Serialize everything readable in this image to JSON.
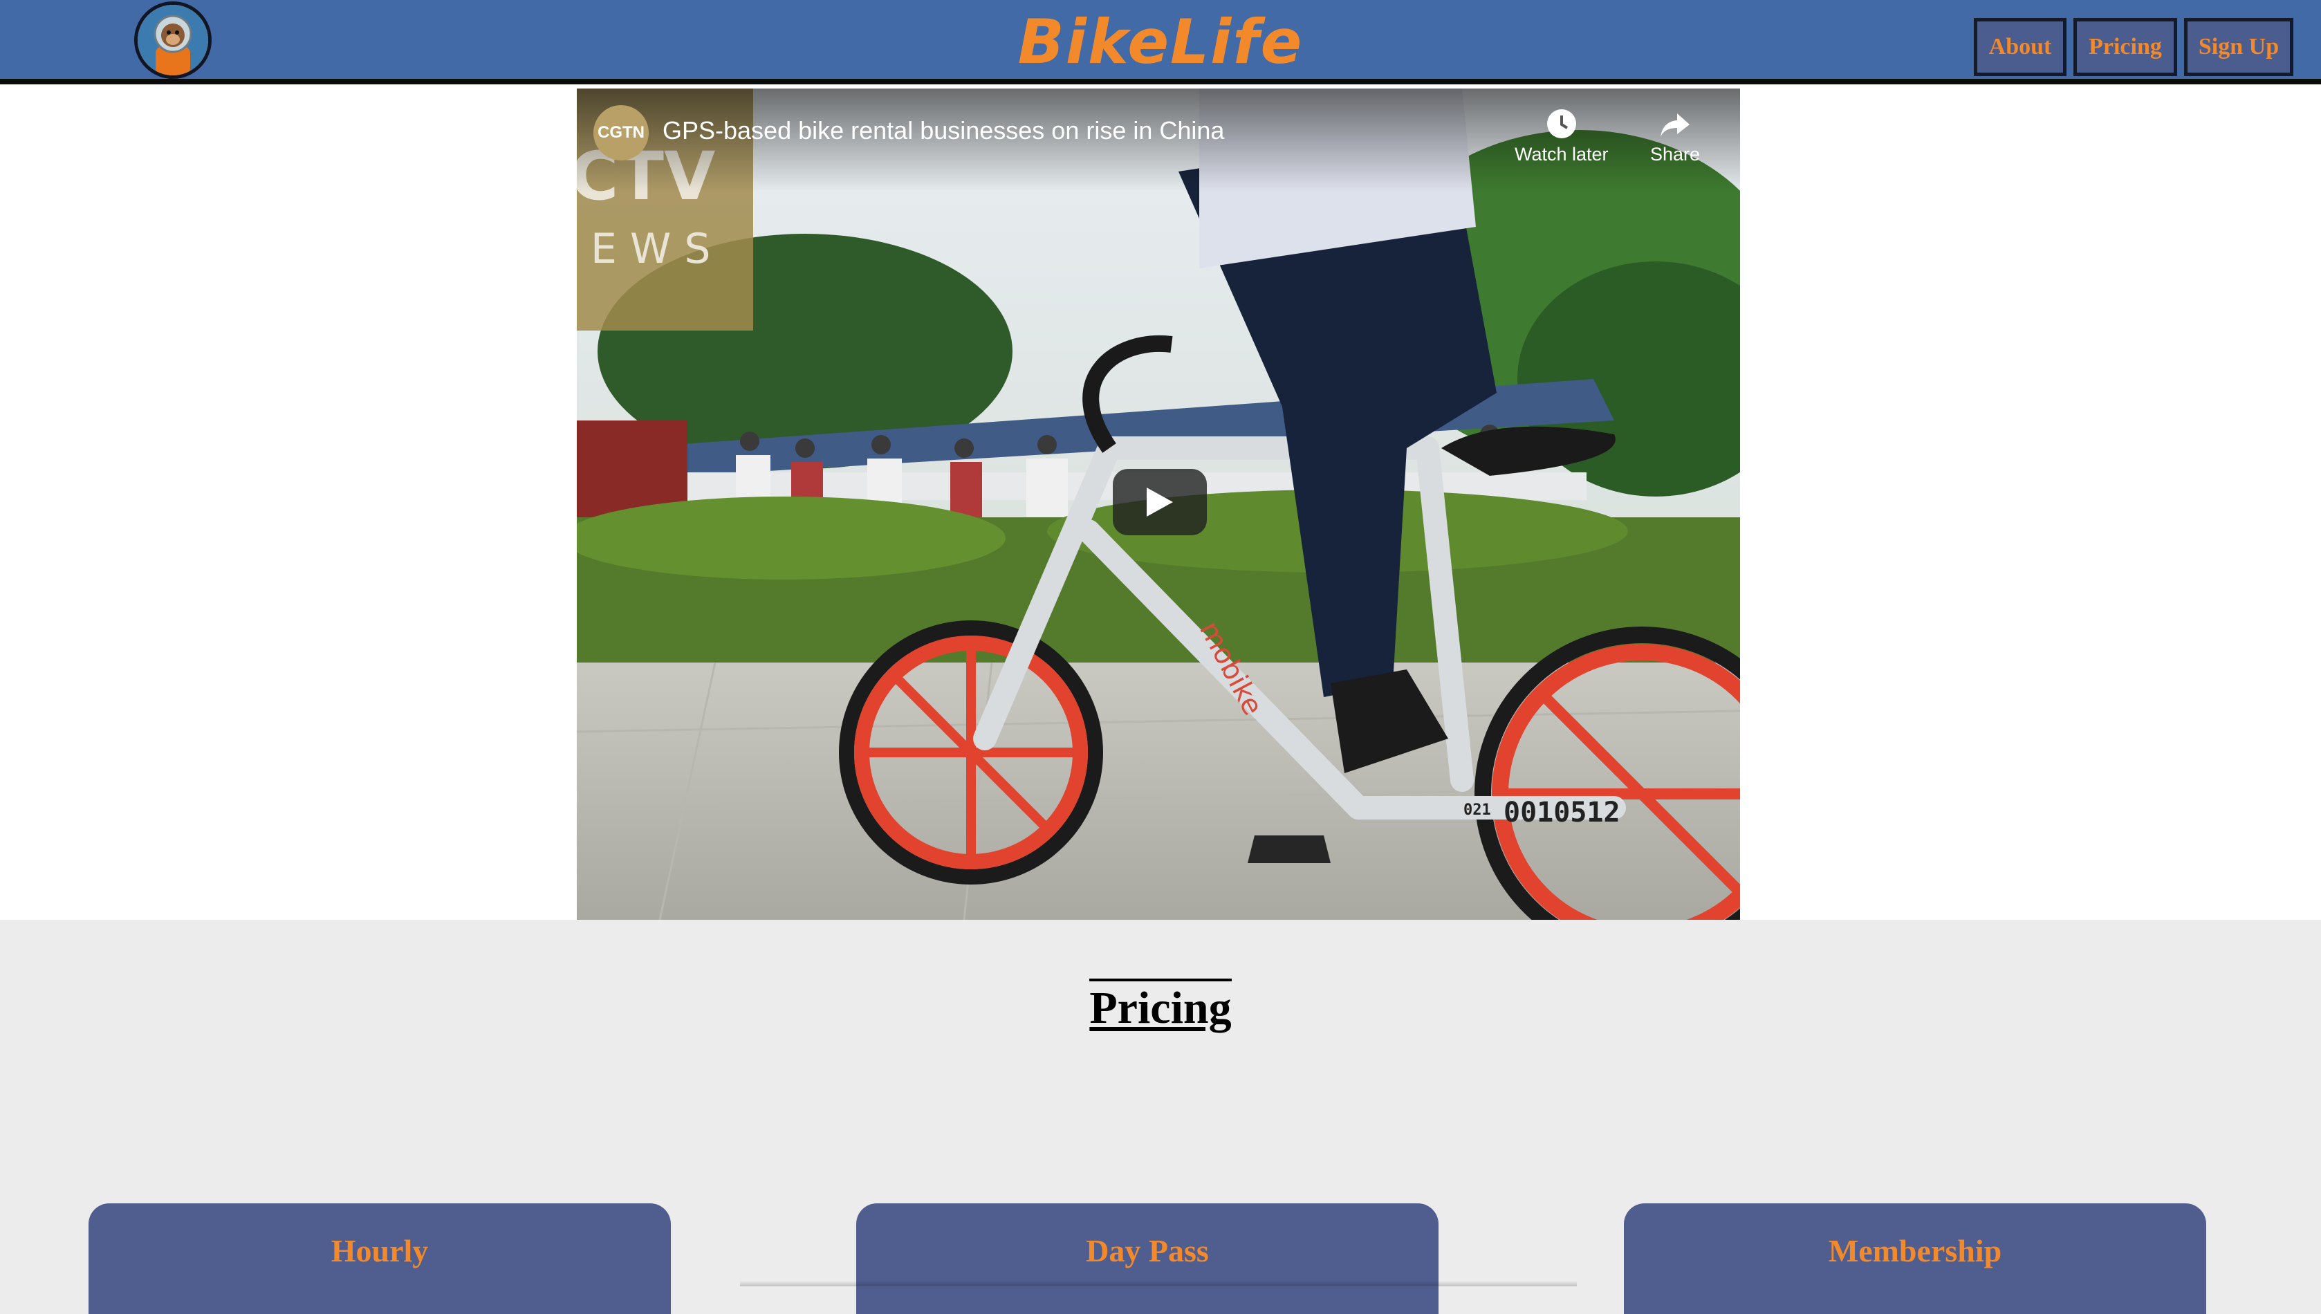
{
  "header": {
    "brand": "BikeLife",
    "nav": [
      {
        "label": "About"
      },
      {
        "label": "Pricing"
      },
      {
        "label": "Sign Up"
      }
    ],
    "colors": {
      "bar": "#416aa6",
      "accent": "#f28a2c",
      "button": "#4b5c8f"
    }
  },
  "video": {
    "channel": "CGTN",
    "title": "GPS-based bike rental businesses on rise in China",
    "watermark_line1": "CTV",
    "watermark_line2": "E W S",
    "frame_number": "0010512",
    "frame_prefix": "021",
    "bike_brand": "mobike",
    "actions": [
      {
        "label": "Watch later",
        "icon": "clock-icon"
      },
      {
        "label": "Share",
        "icon": "share-arrow-icon"
      }
    ]
  },
  "pricing": {
    "heading": "Pricing",
    "cards": [
      {
        "title": "Hourly"
      },
      {
        "title": "Day Pass"
      },
      {
        "title": "Membership"
      }
    ],
    "card_color": "#4f5d8f"
  }
}
